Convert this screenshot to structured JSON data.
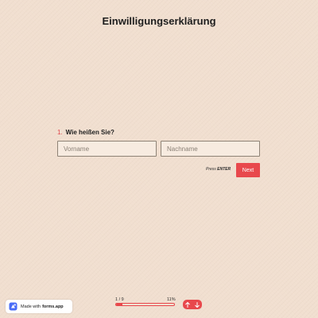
{
  "form": {
    "title": "Einwilligungserklärung"
  },
  "question": {
    "number": "1.",
    "text": "Wie heißen Sie?",
    "first_name_placeholder": "Vorname",
    "last_name_placeholder": "Nachname"
  },
  "actions": {
    "press_prefix": "Press",
    "press_key": "ENTER",
    "next_label": "Next"
  },
  "progress": {
    "count": "1 / 9",
    "percent": "11%",
    "fraction": 0.11
  },
  "footer": {
    "made_with": "Made with",
    "brand": "forms.app"
  },
  "icons": {
    "logo": "forms-app-logo-icon",
    "up": "arrow-up-icon",
    "down": "arrow-down-icon"
  },
  "colors": {
    "accent": "#e8484c",
    "background": "#f1dfd0"
  }
}
